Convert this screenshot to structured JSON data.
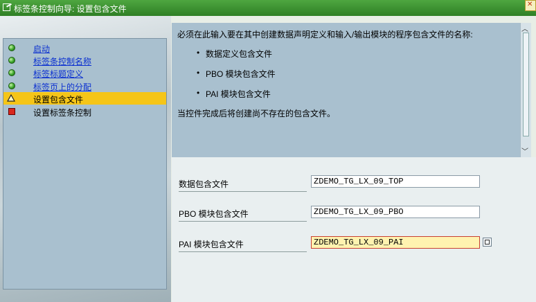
{
  "window": {
    "title": "标签条控制向导: 设置包含文件"
  },
  "nav": {
    "items": [
      {
        "label": "启动",
        "status": "green",
        "link": true
      },
      {
        "label": "标签条控制名称",
        "status": "green",
        "link": true
      },
      {
        "label": "标签标题定义",
        "status": "green",
        "link": true
      },
      {
        "label": "标签页上的分配",
        "status": "green",
        "link": true
      },
      {
        "label": "设置包含文件",
        "status": "warning",
        "active": true
      },
      {
        "label": "设置标签条控制",
        "status": "red"
      }
    ]
  },
  "info": {
    "intro": "必须在此输入要在其中创建数据声明定义和输入/输出模块的程序包含文件的名称:",
    "bullets": [
      "数据定义包含文件",
      "PBO 模块包含文件",
      "PAI 模块包含文件"
    ],
    "note": "当控件完成后将创建尚不存在的包含文件。"
  },
  "form": {
    "fields": [
      {
        "label": "数据包含文件",
        "value": "ZDEMO_TG_LX_09_TOP"
      },
      {
        "label": "PBO 模块包含文件",
        "value": "ZDEMO_TG_LX_09_PBO"
      },
      {
        "label": "PAI 模块包含文件",
        "value": "ZDEMO_TG_LX_09_PAI"
      }
    ]
  },
  "colors": {
    "titlebar": "#3a9230",
    "active_item": "#f5c518",
    "info_bg": "#a9c0cf",
    "focused_input": "#fff3b0"
  }
}
